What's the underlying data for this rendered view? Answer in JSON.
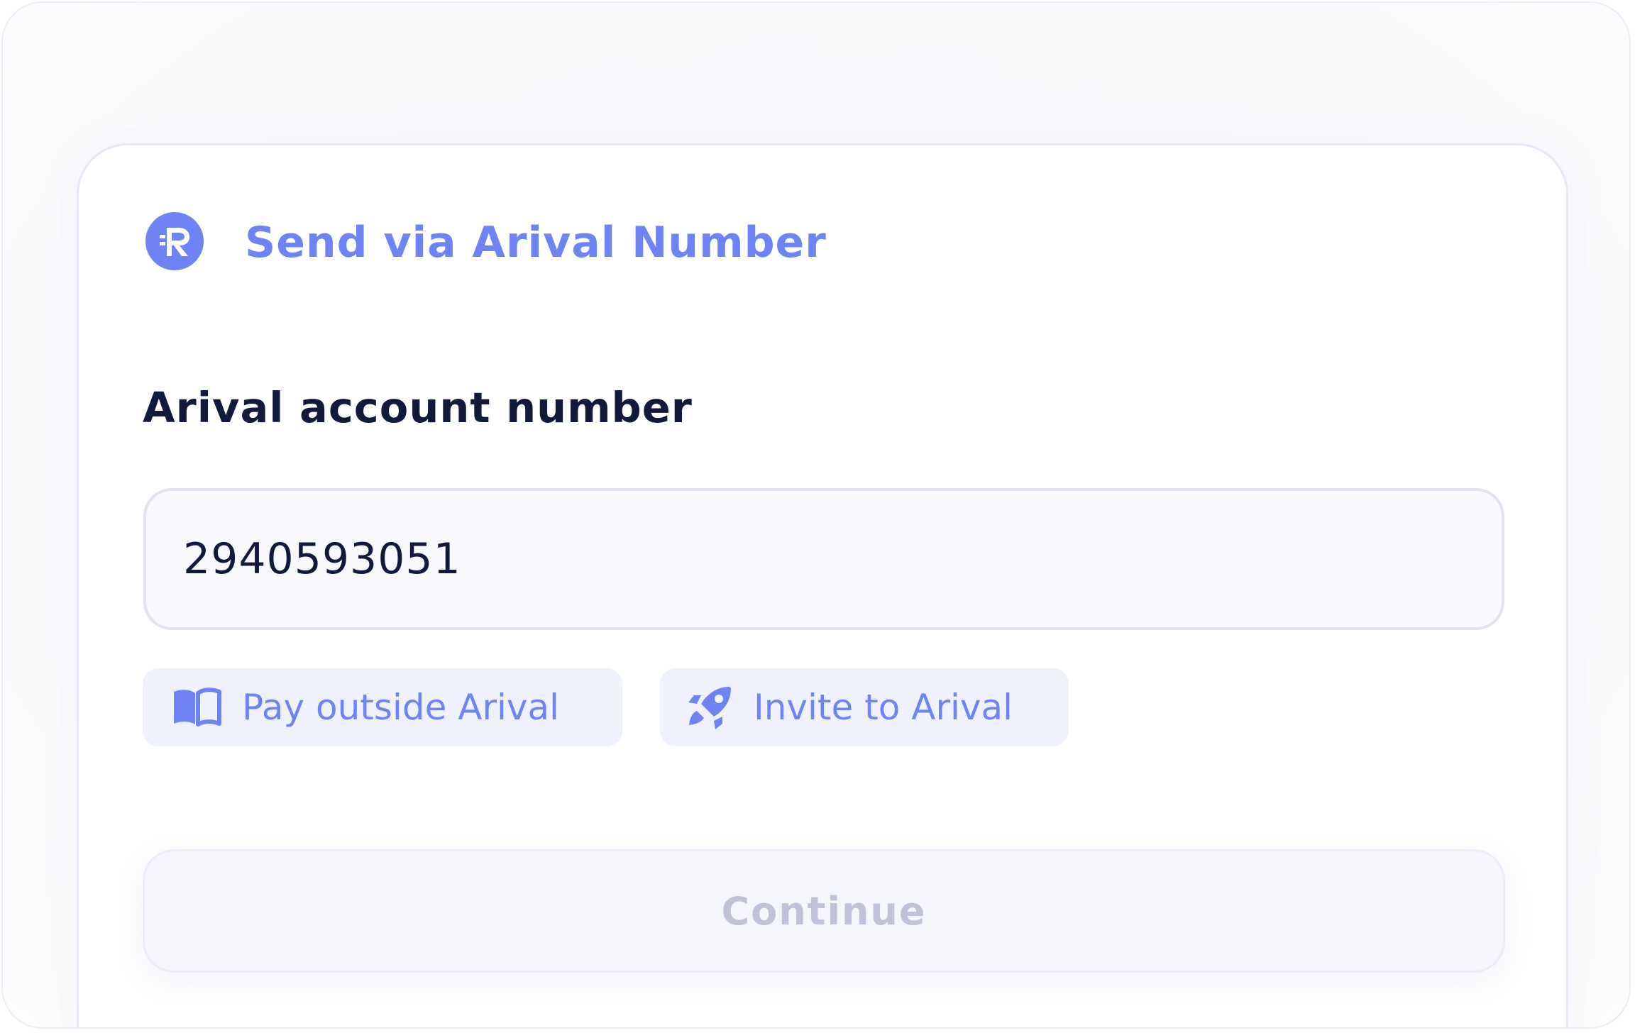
{
  "header": {
    "logo_icon": "arival-r-logo-icon",
    "title": "Send via Arival Number"
  },
  "form": {
    "account_label": "Arival account number",
    "account_value": "2940593051"
  },
  "shortcuts": [
    {
      "label": "Pay outside Arival",
      "icon": "book-open-icon"
    },
    {
      "label": "Invite to Arival",
      "icon": "rocket-icon"
    }
  ],
  "actions": {
    "continue_label": "Continue",
    "continue_disabled": true
  },
  "colors": {
    "accent": "#6f84f4",
    "text_dark": "#121a3c",
    "chip_bg": "#eff1fd",
    "disabled_text": "#c2c1da"
  }
}
